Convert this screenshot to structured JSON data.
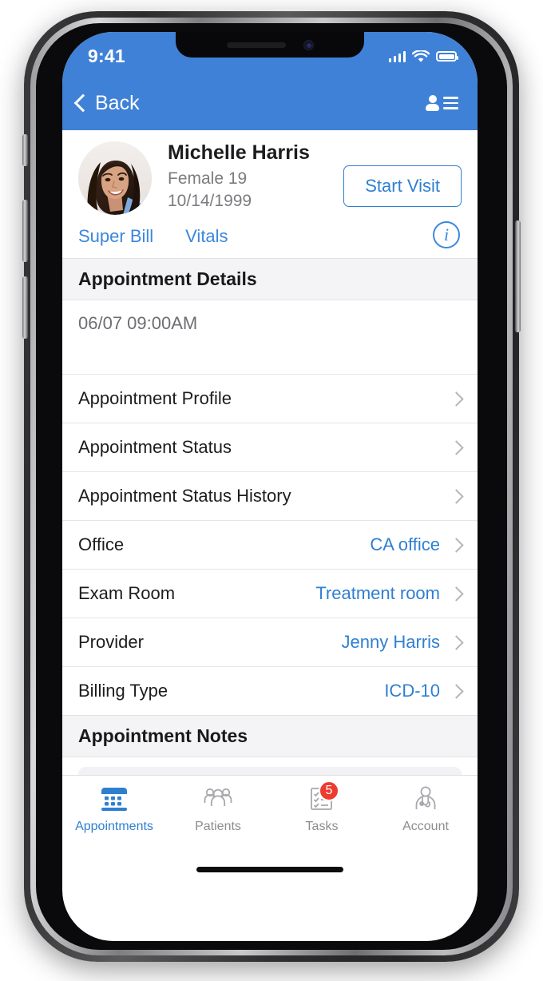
{
  "theme": {
    "header_blue": "#3f81d7",
    "link_blue": "#2f7fd1",
    "badge_red": "#ec3b30",
    "section_gray": "#f4f4f6"
  },
  "status_bar": {
    "time": "9:41",
    "signal_icon": "cellular-signal-icon",
    "wifi_icon": "wifi-icon",
    "battery_icon": "battery-full-icon"
  },
  "nav_bar": {
    "back_label": "Back",
    "back_icon": "chevron-left-icon",
    "right_icon": "contact-list-icon"
  },
  "patient": {
    "avatar_icon": "patient-avatar-photo",
    "name": "Michelle Harris",
    "gender_age": "Female 19",
    "dob": "10/14/1999",
    "start_visit_label": "Start Visit",
    "info_icon": "info-circle-icon",
    "tabs": [
      {
        "label": "Super Bill"
      },
      {
        "label": "Vitals"
      }
    ]
  },
  "appointment_details": {
    "section_title": "Appointment Details",
    "datetime": "06/07 09:00AM",
    "rows": [
      {
        "label": "Appointment Profile",
        "value": ""
      },
      {
        "label": "Appointment Status",
        "value": ""
      },
      {
        "label": "Appointment Status History",
        "value": ""
      },
      {
        "label": "Office",
        "value": "CA office"
      },
      {
        "label": "Exam Room",
        "value": "Treatment room"
      },
      {
        "label": "Provider",
        "value": "Jenny Harris"
      },
      {
        "label": "Billing Type",
        "value": "ICD-10"
      }
    ]
  },
  "appointment_notes": {
    "section_title": "Appointment Notes",
    "notes_value": "",
    "notes_placeholder": ""
  },
  "tab_bar": {
    "tabs": [
      {
        "label": "Appointments",
        "icon": "calendar-icon",
        "active": true,
        "badge": ""
      },
      {
        "label": "Patients",
        "icon": "people-group-icon",
        "active": false,
        "badge": ""
      },
      {
        "label": "Tasks",
        "icon": "checklist-icon",
        "active": false,
        "badge": "5"
      },
      {
        "label": "Account",
        "icon": "doctor-stethoscope-icon",
        "active": false,
        "badge": ""
      }
    ]
  }
}
